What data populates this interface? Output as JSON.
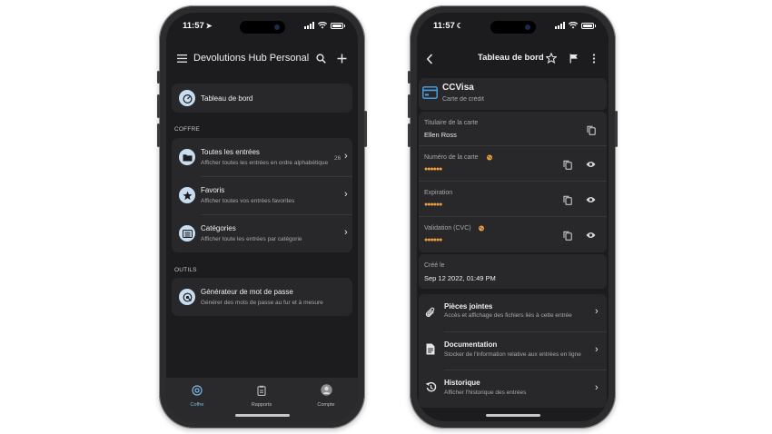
{
  "left_phone": {
    "status": {
      "time": "11:57",
      "indicator_glyph": "➤"
    },
    "appbar": {
      "title": "Devolutions Hub Personal"
    },
    "dashboard_item": {
      "label": "Tableau de bord"
    },
    "section_vault": "COFFRE",
    "entries": [
      {
        "title": "Toutes les entrées",
        "subtitle": "Afficher toutes les entrées en ordre alphabétique",
        "count": "26",
        "icon": "folder-icon"
      },
      {
        "title": "Favoris",
        "subtitle": "Afficher toutes vos entrées favorites",
        "icon": "star-icon"
      },
      {
        "title": "Catégories",
        "subtitle": "Afficher toute les entrées par catégorie",
        "icon": "list-icon"
      }
    ],
    "section_tools": "OUTILS",
    "tools": [
      {
        "title": "Générateur de mot de passe",
        "subtitle": "Générer des mots de passe au fur et à mesure",
        "icon": "password-generator-icon"
      }
    ],
    "tabbar": [
      {
        "label": "Coffre",
        "active": true,
        "icon": "vault-icon"
      },
      {
        "label": "Rapports",
        "active": false,
        "icon": "clipboard-icon"
      },
      {
        "label": "Compte",
        "active": false,
        "icon": "avatar-icon"
      }
    ],
    "accent": "#7ab8e8"
  },
  "right_phone": {
    "status": {
      "time": "11:57",
      "indicator_glyph": "☾"
    },
    "appbar": {
      "title": "Tableau de bord"
    },
    "entry": {
      "name": "CCVisa",
      "type": "Carte de crédit",
      "icon": "credit-card-icon"
    },
    "fields": [
      {
        "label": "Titulaire de la carte",
        "value": "Ellen Ross",
        "masked": false,
        "sensitive": false
      },
      {
        "label": "Numéro de la carte",
        "value": "●●●●●●",
        "masked": true,
        "sensitive": true
      },
      {
        "label": "Expiration",
        "value": "●●●●●●",
        "masked": true,
        "sensitive": false
      },
      {
        "label": "Validation (CVC)",
        "value": "●●●●●●",
        "masked": true,
        "sensitive": true
      }
    ],
    "created": {
      "label": "Créé le",
      "value": "Sep 12 2022, 01:49 PM"
    },
    "links": [
      {
        "title": "Pièces jointes",
        "subtitle": "Accès et affichage des fichiers liés à cette entrée",
        "icon": "paperclip-icon"
      },
      {
        "title": "Documentation",
        "subtitle": "Stocker de l'information relative aux entrées en ligne",
        "icon": "document-icon"
      },
      {
        "title": "Historique",
        "subtitle": "Afficher l'historique des entrées",
        "icon": "history-icon"
      }
    ],
    "masked_color": "#f0a040",
    "card_icon_color": "#4aa3ea"
  }
}
